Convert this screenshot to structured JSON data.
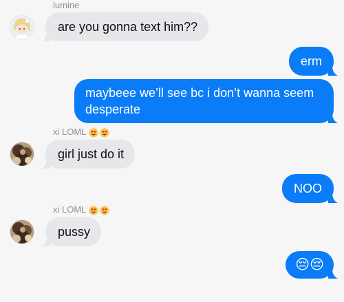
{
  "messages": [
    {
      "sender": "lumine",
      "text": "are you gonna text him??"
    },
    {
      "text": "erm"
    },
    {
      "text": "maybeee we’ll see bc i don’t wanna seem desperate"
    },
    {
      "sender": "xi LOML",
      "sender_emojis": "😍😍",
      "text": "girl just do it"
    },
    {
      "text": "NOO"
    },
    {
      "sender": "xi LOML",
      "sender_emojis": "😍😍",
      "text": "pussy"
    },
    {
      "text": "😔😔"
    }
  ],
  "colors": {
    "background": "#f6f6f6",
    "incoming_bubble": "#e7e7eb",
    "outgoing_bubble": "#0a7cf7",
    "sender_label": "#8e8e93"
  },
  "icons": {
    "lumine_avatar": "anime-avatar-icon",
    "xi_avatar": "photo-avatar-icon",
    "heart_eyes": "heart-eyes-emoji-icon",
    "pensive": "pensive-emoji-icon"
  }
}
